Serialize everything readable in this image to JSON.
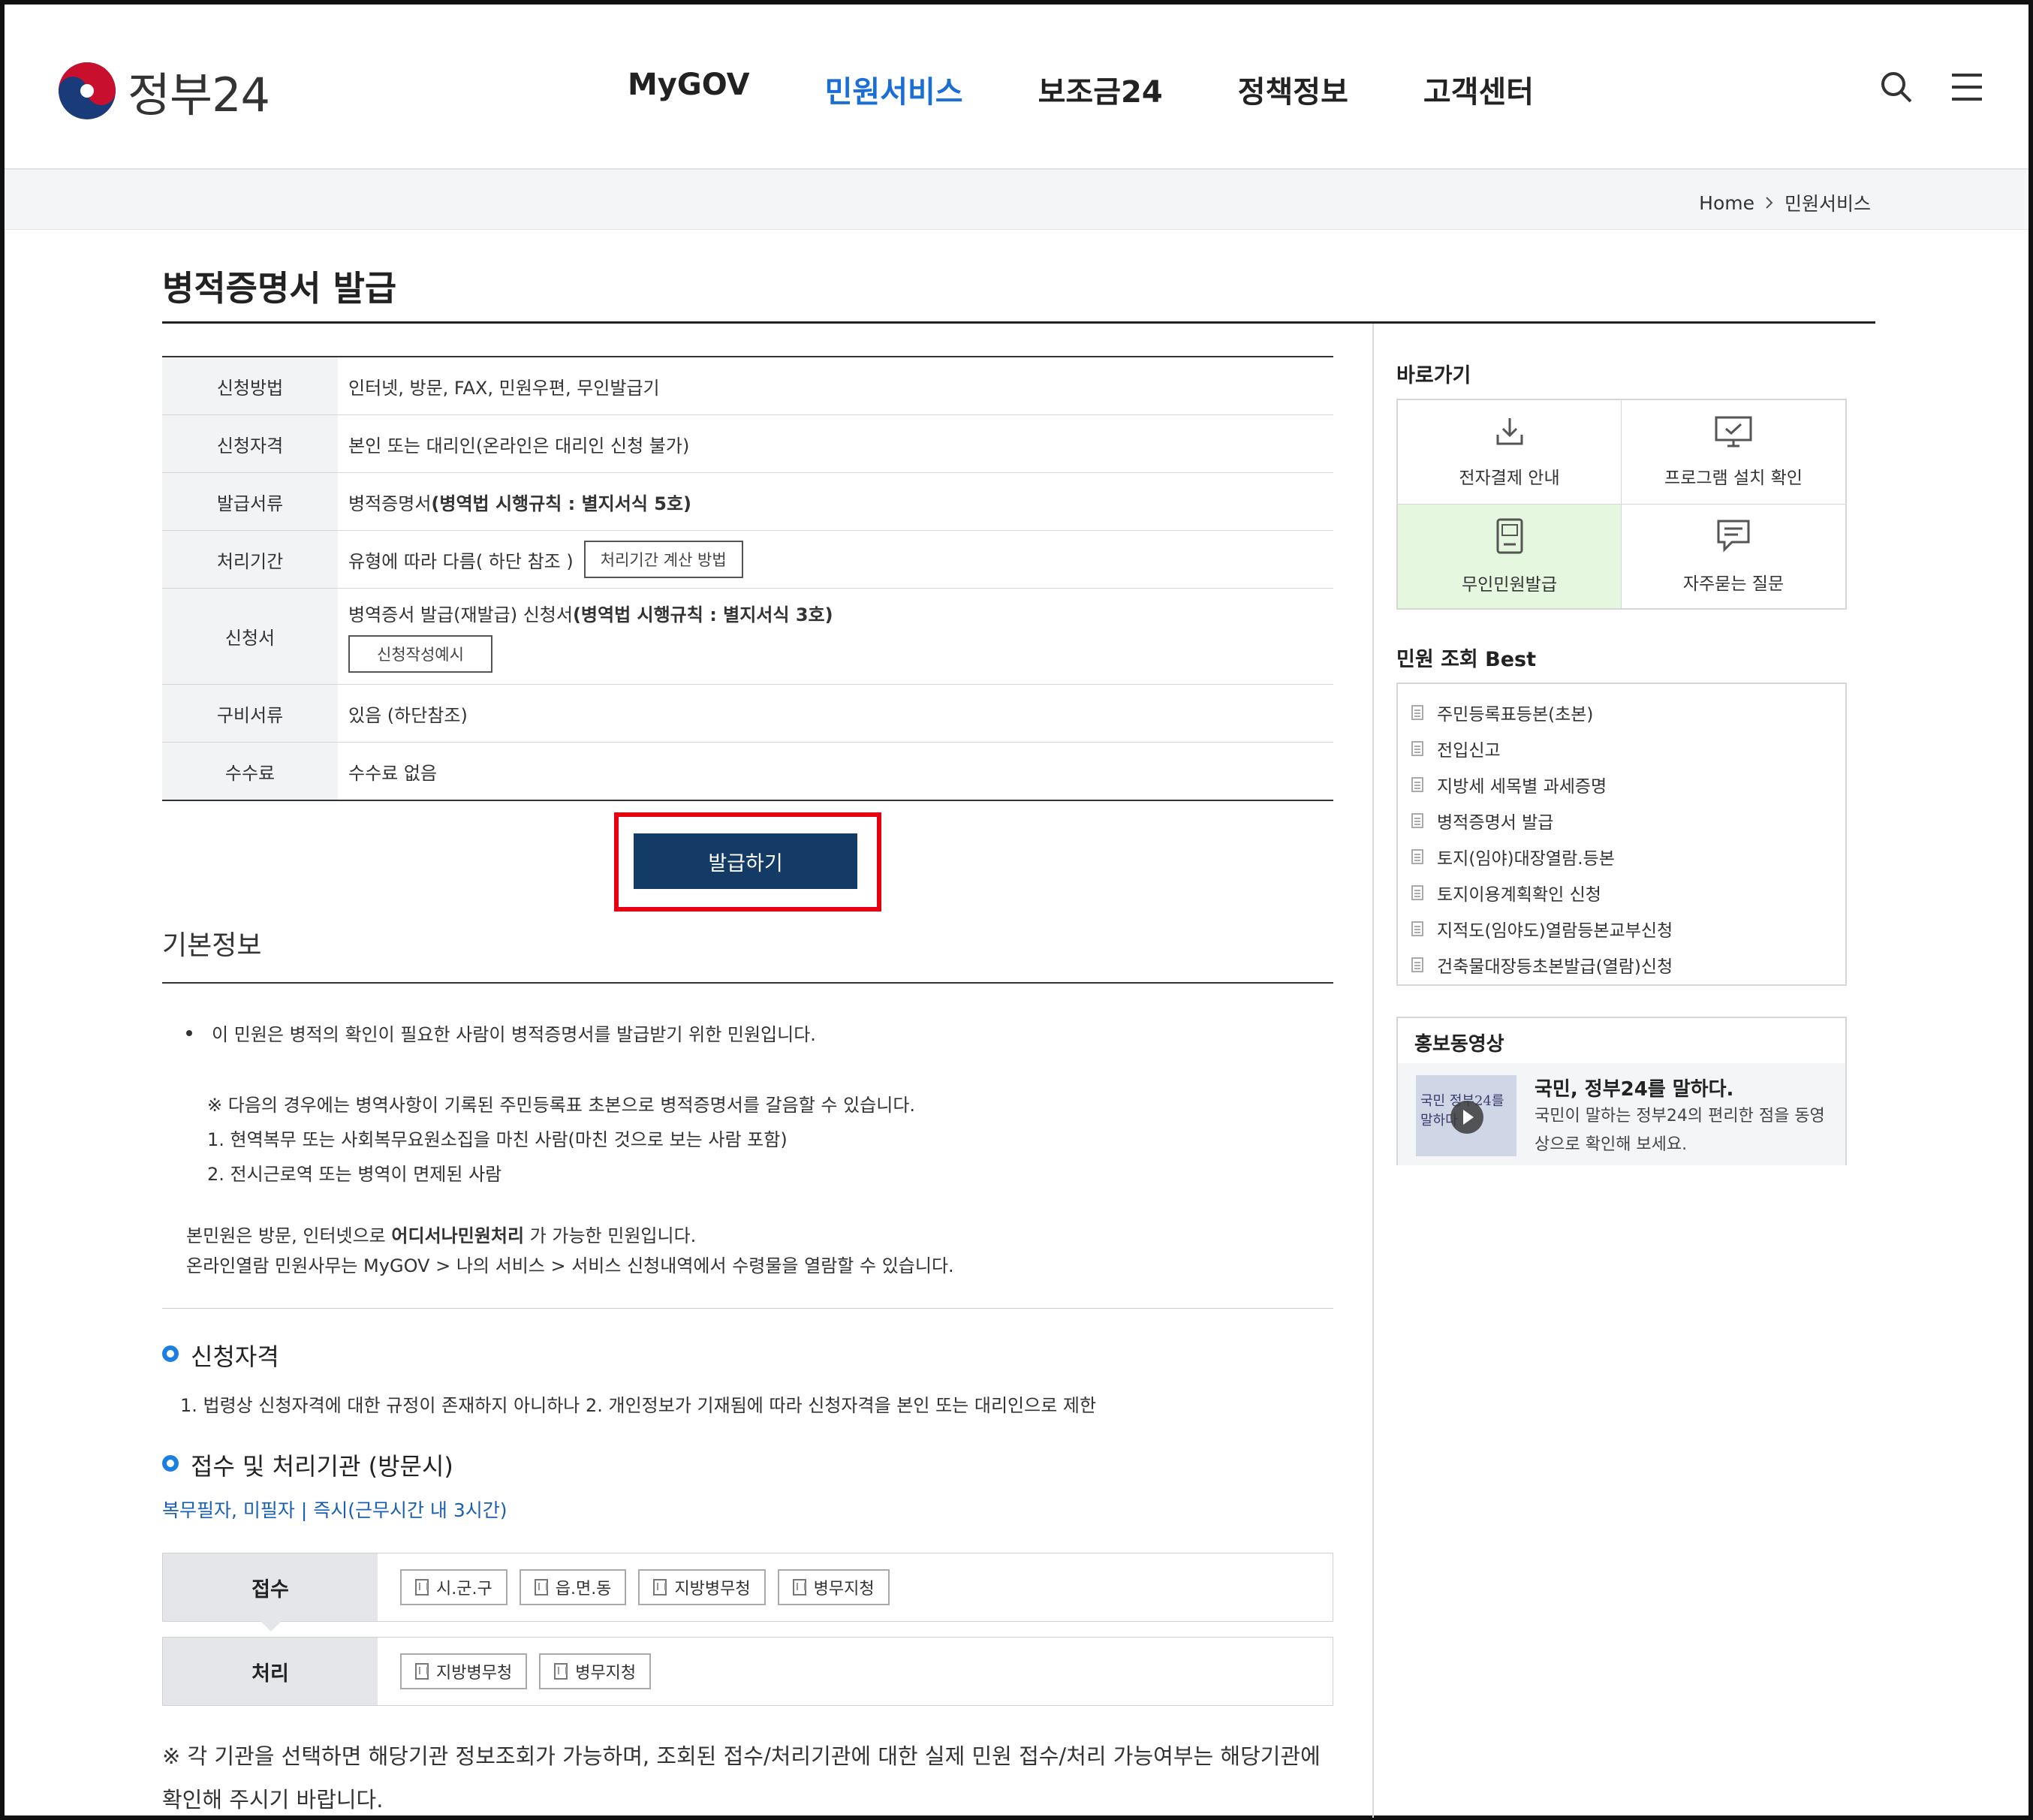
{
  "header": {
    "logo_text": "정부24",
    "nav": [
      "MyGOV",
      "민원서비스",
      "보조금24",
      "정책정보",
      "고객센터"
    ],
    "active_nav": "민원서비스",
    "icons": [
      "search-icon",
      "menu-icon"
    ]
  },
  "breadcrumb": {
    "home": "Home",
    "current": "민원서비스"
  },
  "page": {
    "title": "병적증명서 발급"
  },
  "info_table": {
    "method_label": "신청방법",
    "method_value": "인터넷, 방문, FAX, 민원우편, 무인발급기",
    "eligibility_label": "신청자격",
    "eligibility_value": "본인 또는 대리인(온라인은 대리인 신청 불가)",
    "document_label": "발급서류",
    "document_value": "병적증명서 ",
    "document_bold": "(병역법 시행규칙 : 별지서식 5호)",
    "period_label": "처리기간",
    "period_value": "유형에 따라 다름( 하단 참조 )",
    "period_button": "처리기간 계산 방법",
    "form_label": "신청서",
    "form_value": "병역증서 발급(재발급) 신청서 ",
    "form_bold": "(병역법 시행규칙 : 별지서식 3호)",
    "form_button": "신청작성예시",
    "docs_label": "구비서류",
    "docs_value": "있음 (하단참조)",
    "fee_label": "수수료",
    "fee_value": "수수료 없음"
  },
  "issue_button": "발급하기",
  "basic_info": {
    "heading": "기본정보",
    "bullet": "이 민원은 병적의 확인이 필요한 사람이 병적증명서를 발급받기 위한 민원입니다.",
    "note_line": "※ 다음의 경우에는 병역사항이 기록된 주민등록표 초본으로 병적증명서를 갈음할 수 있습니다.",
    "case1": "1. 현역복무 또는 사회복무요원소집을 마친 사람(마친 것으로 보는 사람 포함)",
    "case2": "2. 전시근로역 또는 병역이 면제된 사람",
    "line_a_pre": "본민원은 방문, 인터넷으로 ",
    "line_a_bold": "어디서나민원처리",
    "line_a_post": " 가 가능한 민원입니다.",
    "line_b": "온라인열람 민원사무는 MyGOV > 나의 서비스 > 서비스 신청내역에서 수령물을 열람할 수 있습니다."
  },
  "eligibility_section": {
    "heading": "신청자격",
    "text": "1. 법령상 신청자격에 대한 규정이 존재하지 아니하나 2. 개인정보가 기재됨에 따라 신청자격을 본인 또는 대리인으로 제한"
  },
  "agency_section": {
    "heading": "접수 및 처리기관 (방문시)",
    "link": "복무필자, 미필자 | 즉시(근무시간 내 3시간)",
    "receive_label": "접수",
    "receive_items": [
      "시.군.구",
      "읍.면.동",
      "지방병무청",
      "병무지청"
    ],
    "process_label": "처리",
    "process_items": [
      "지방병무청",
      "병무지청"
    ]
  },
  "bottom_note": "※ 각 기관을 선택하면 해당기관 정보조회가 가능하며, 조회된 접수/처리기관에 대한 실제 민원 접수/처리 가능여부는 해당기관에 확인해 주시기 바랍니다.",
  "sidebar": {
    "quick_heading": "바로가기",
    "quick": [
      {
        "label": "전자결제 안내",
        "icon": "download-icon"
      },
      {
        "label": "프로그램 설치 확인",
        "icon": "monitor-check-icon"
      },
      {
        "label": "무인민원발급",
        "icon": "kiosk-icon"
      },
      {
        "label": "자주묻는 질문",
        "icon": "faq-icon"
      }
    ],
    "best_heading": "민원 조회 Best",
    "best": [
      "주민등록표등본(초본)",
      "전입신고",
      "지방세 세목별 과세증명",
      "병적증명서 발급",
      "토지(임야)대장열람.등본",
      "토지이용계획확인 신청",
      "지적도(임야도)열람등본교부신청",
      "건축물대장등초본발급(열람)신청"
    ],
    "promo_heading": "홍보동영상",
    "promo_title": "국민, 정부24를 말하다.",
    "promo_desc": "국민이 말하는 정부24의 편리한 점을 동영상으로 확인해 보세요.",
    "promo_thumb_text": "국민 정부24를 말하다"
  },
  "colors": {
    "accent": "#1a6ed6",
    "button": "#143a66",
    "highlight": "#e60012",
    "green_cell": "#e6f7df"
  }
}
